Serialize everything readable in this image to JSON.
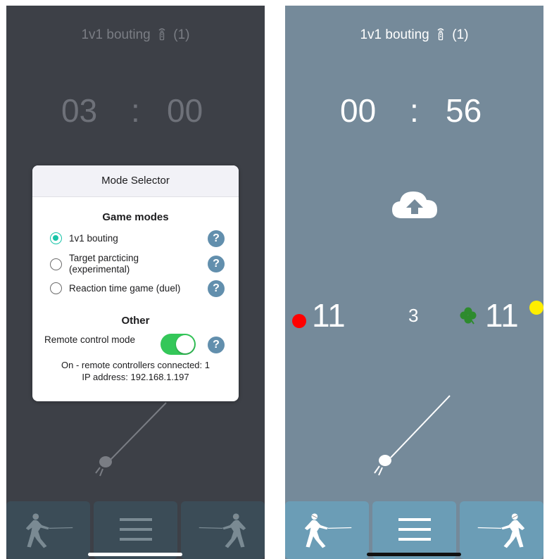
{
  "left_screen": {
    "title": "1v1 bouting",
    "title_count": "(1)",
    "timer": {
      "minutes": "03",
      "separator": ":",
      "seconds": "00"
    },
    "modal": {
      "header": "Mode Selector",
      "game_modes_title": "Game modes",
      "modes": [
        {
          "label": "1v1 bouting",
          "selected": true
        },
        {
          "label": "Target parcticing (experimental)",
          "selected": false
        },
        {
          "label": "Reaction time game (duel)",
          "selected": false
        }
      ],
      "help_symbol": "?",
      "other_title": "Other",
      "remote_control_label": "Remote control mode",
      "remote_control_on": true,
      "status_line1": "On - remote controllers connected: 1",
      "status_line2": "IP address: 192.168.1.197"
    },
    "footer": {
      "left_icon": "fencer-left-icon",
      "menu_icon": "hamburger-menu-icon",
      "right_icon": "fencer-right-icon"
    }
  },
  "right_screen": {
    "title": "1v1 bouting",
    "title_count": "(1)",
    "timer": {
      "minutes": "00",
      "separator": ":",
      "seconds": "56"
    },
    "cloud_icon": "cloud-upload-icon",
    "left_score": "11",
    "right_score": "11",
    "period": "3",
    "left_lamp_color": "#ff0000",
    "right_lamp_color": "#ffee00",
    "clover_icon": "clover-icon",
    "footer": {
      "left_icon": "fencer-left-icon",
      "menu_icon": "hamburger-menu-icon",
      "right_icon": "fencer-right-icon"
    }
  },
  "colors": {
    "left_bg": "#3d4047",
    "right_bg": "#758a9a",
    "accent_teal": "#18c4a8",
    "toggle_green": "#34c759",
    "help_blue": "#628fad"
  }
}
